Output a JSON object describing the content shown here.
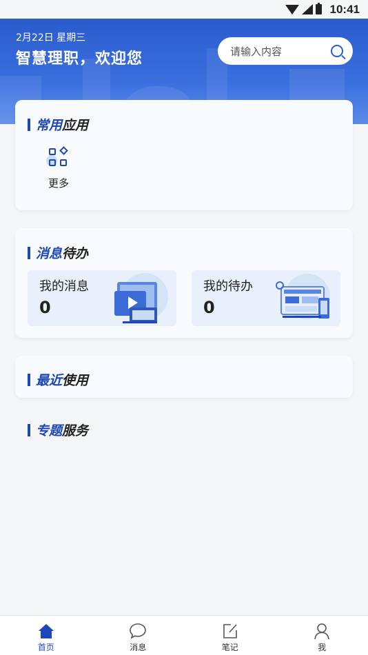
{
  "status_bar": {
    "time": "10:41"
  },
  "header": {
    "date": "2月22日 星期三",
    "welcome": "智慧理职，欢迎您",
    "search_placeholder": "请输入内容"
  },
  "sections": {
    "common_apps": {
      "title_highlight": "常用",
      "title_rest": "应用",
      "items": [
        {
          "label": "更多",
          "icon": "grid-more-icon"
        }
      ]
    },
    "messages": {
      "title_highlight": "消息",
      "title_rest": "待办",
      "tiles": [
        {
          "label": "我的消息",
          "count": "0",
          "icon": "video-messages-illustration"
        },
        {
          "label": "我的待办",
          "count": "0",
          "icon": "dashboard-todo-illustration"
        }
      ]
    },
    "recent": {
      "title_highlight": "最近",
      "title_rest": "使用"
    },
    "topics": {
      "title_highlight": "专题",
      "title_rest": "服务"
    }
  },
  "tabbar": {
    "items": [
      {
        "label": "首页",
        "icon": "home-icon",
        "active": true
      },
      {
        "label": "消息",
        "icon": "chat-bubble-icon",
        "active": false
      },
      {
        "label": "笔记",
        "icon": "edit-note-icon",
        "active": false
      },
      {
        "label": "我",
        "icon": "person-icon",
        "active": false
      }
    ]
  },
  "colors": {
    "primary": "#1d47b8",
    "header": "#2a5bcc",
    "tile_bg": "#e9f0fb"
  }
}
